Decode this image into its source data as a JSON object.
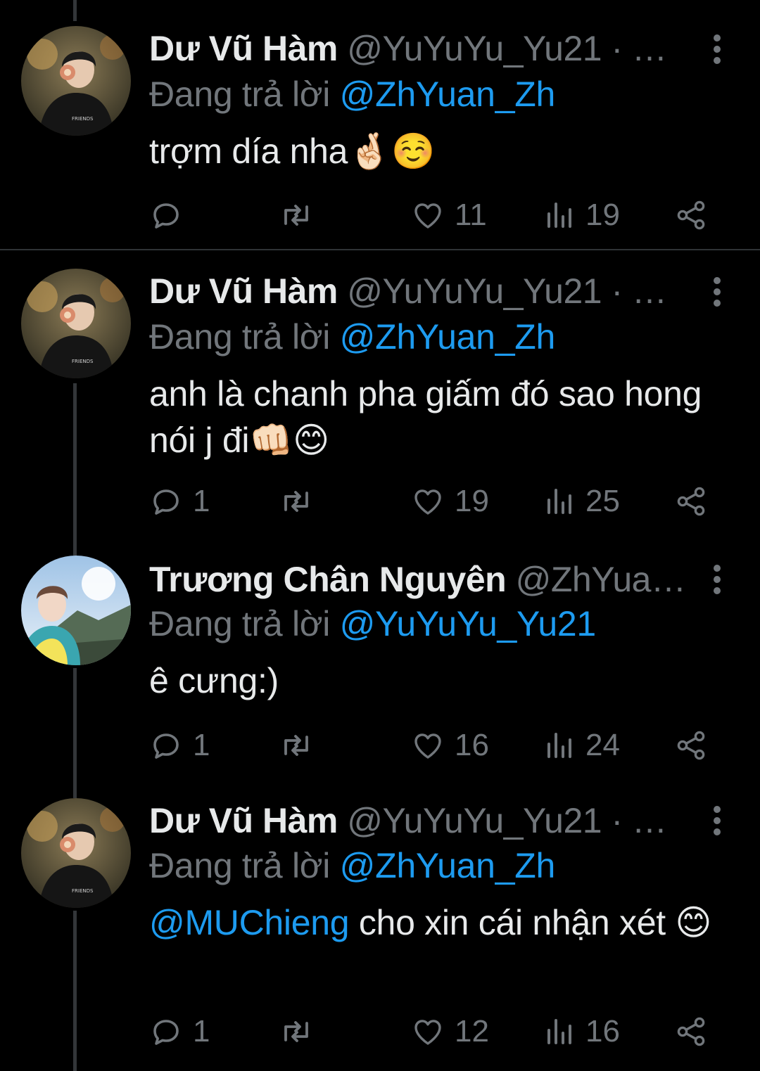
{
  "colors": {
    "background": "#000000",
    "text": "#e7e9ea",
    "secondary": "#71767b",
    "link": "#1d9bf0"
  },
  "tweets": [
    {
      "name": "Dư Vũ Hàm",
      "handle": "@YuYuYu_Yu21 · …",
      "reply_prefix": "Đang trả lời",
      "reply_to": "@ZhYuan_Zh",
      "body_mention": "",
      "body": "trợm día nha🤞🏻☺️",
      "replies": "",
      "likes": "11",
      "views": "19",
      "avatar_icon": "avatar-boy-black-hoodie"
    },
    {
      "name": "Dư Vũ Hàm",
      "handle": "@YuYuYu_Yu21 · …",
      "reply_prefix": "Đang trả lời",
      "reply_to": "@ZhYuan_Zh",
      "body_mention": "",
      "body": "anh là chanh pha giấm đó sao hong nói j đi👊🏻😊",
      "replies": "1",
      "likes": "19",
      "views": "25",
      "avatar_icon": "avatar-boy-black-hoodie"
    },
    {
      "name": "Trương Chân Nguyên",
      "handle": "@ZhYua…",
      "reply_prefix": "Đang trả lời",
      "reply_to": "@YuYuYu_Yu21",
      "body_mention": "",
      "body": "ê cưng:)",
      "replies": "1",
      "likes": "16",
      "views": "24",
      "avatar_icon": "avatar-boy-mountain-sky"
    },
    {
      "name": "Dư Vũ Hàm",
      "handle": "@YuYuYu_Yu21 · …",
      "reply_prefix": "Đang trả lời",
      "reply_to": "@ZhYuan_Zh",
      "body_mention": "@MUChieng",
      "body": " cho xin cái nhận xét 😊",
      "replies": "1",
      "likes": "12",
      "views": "16",
      "avatar_icon": "avatar-boy-black-hoodie"
    }
  ]
}
